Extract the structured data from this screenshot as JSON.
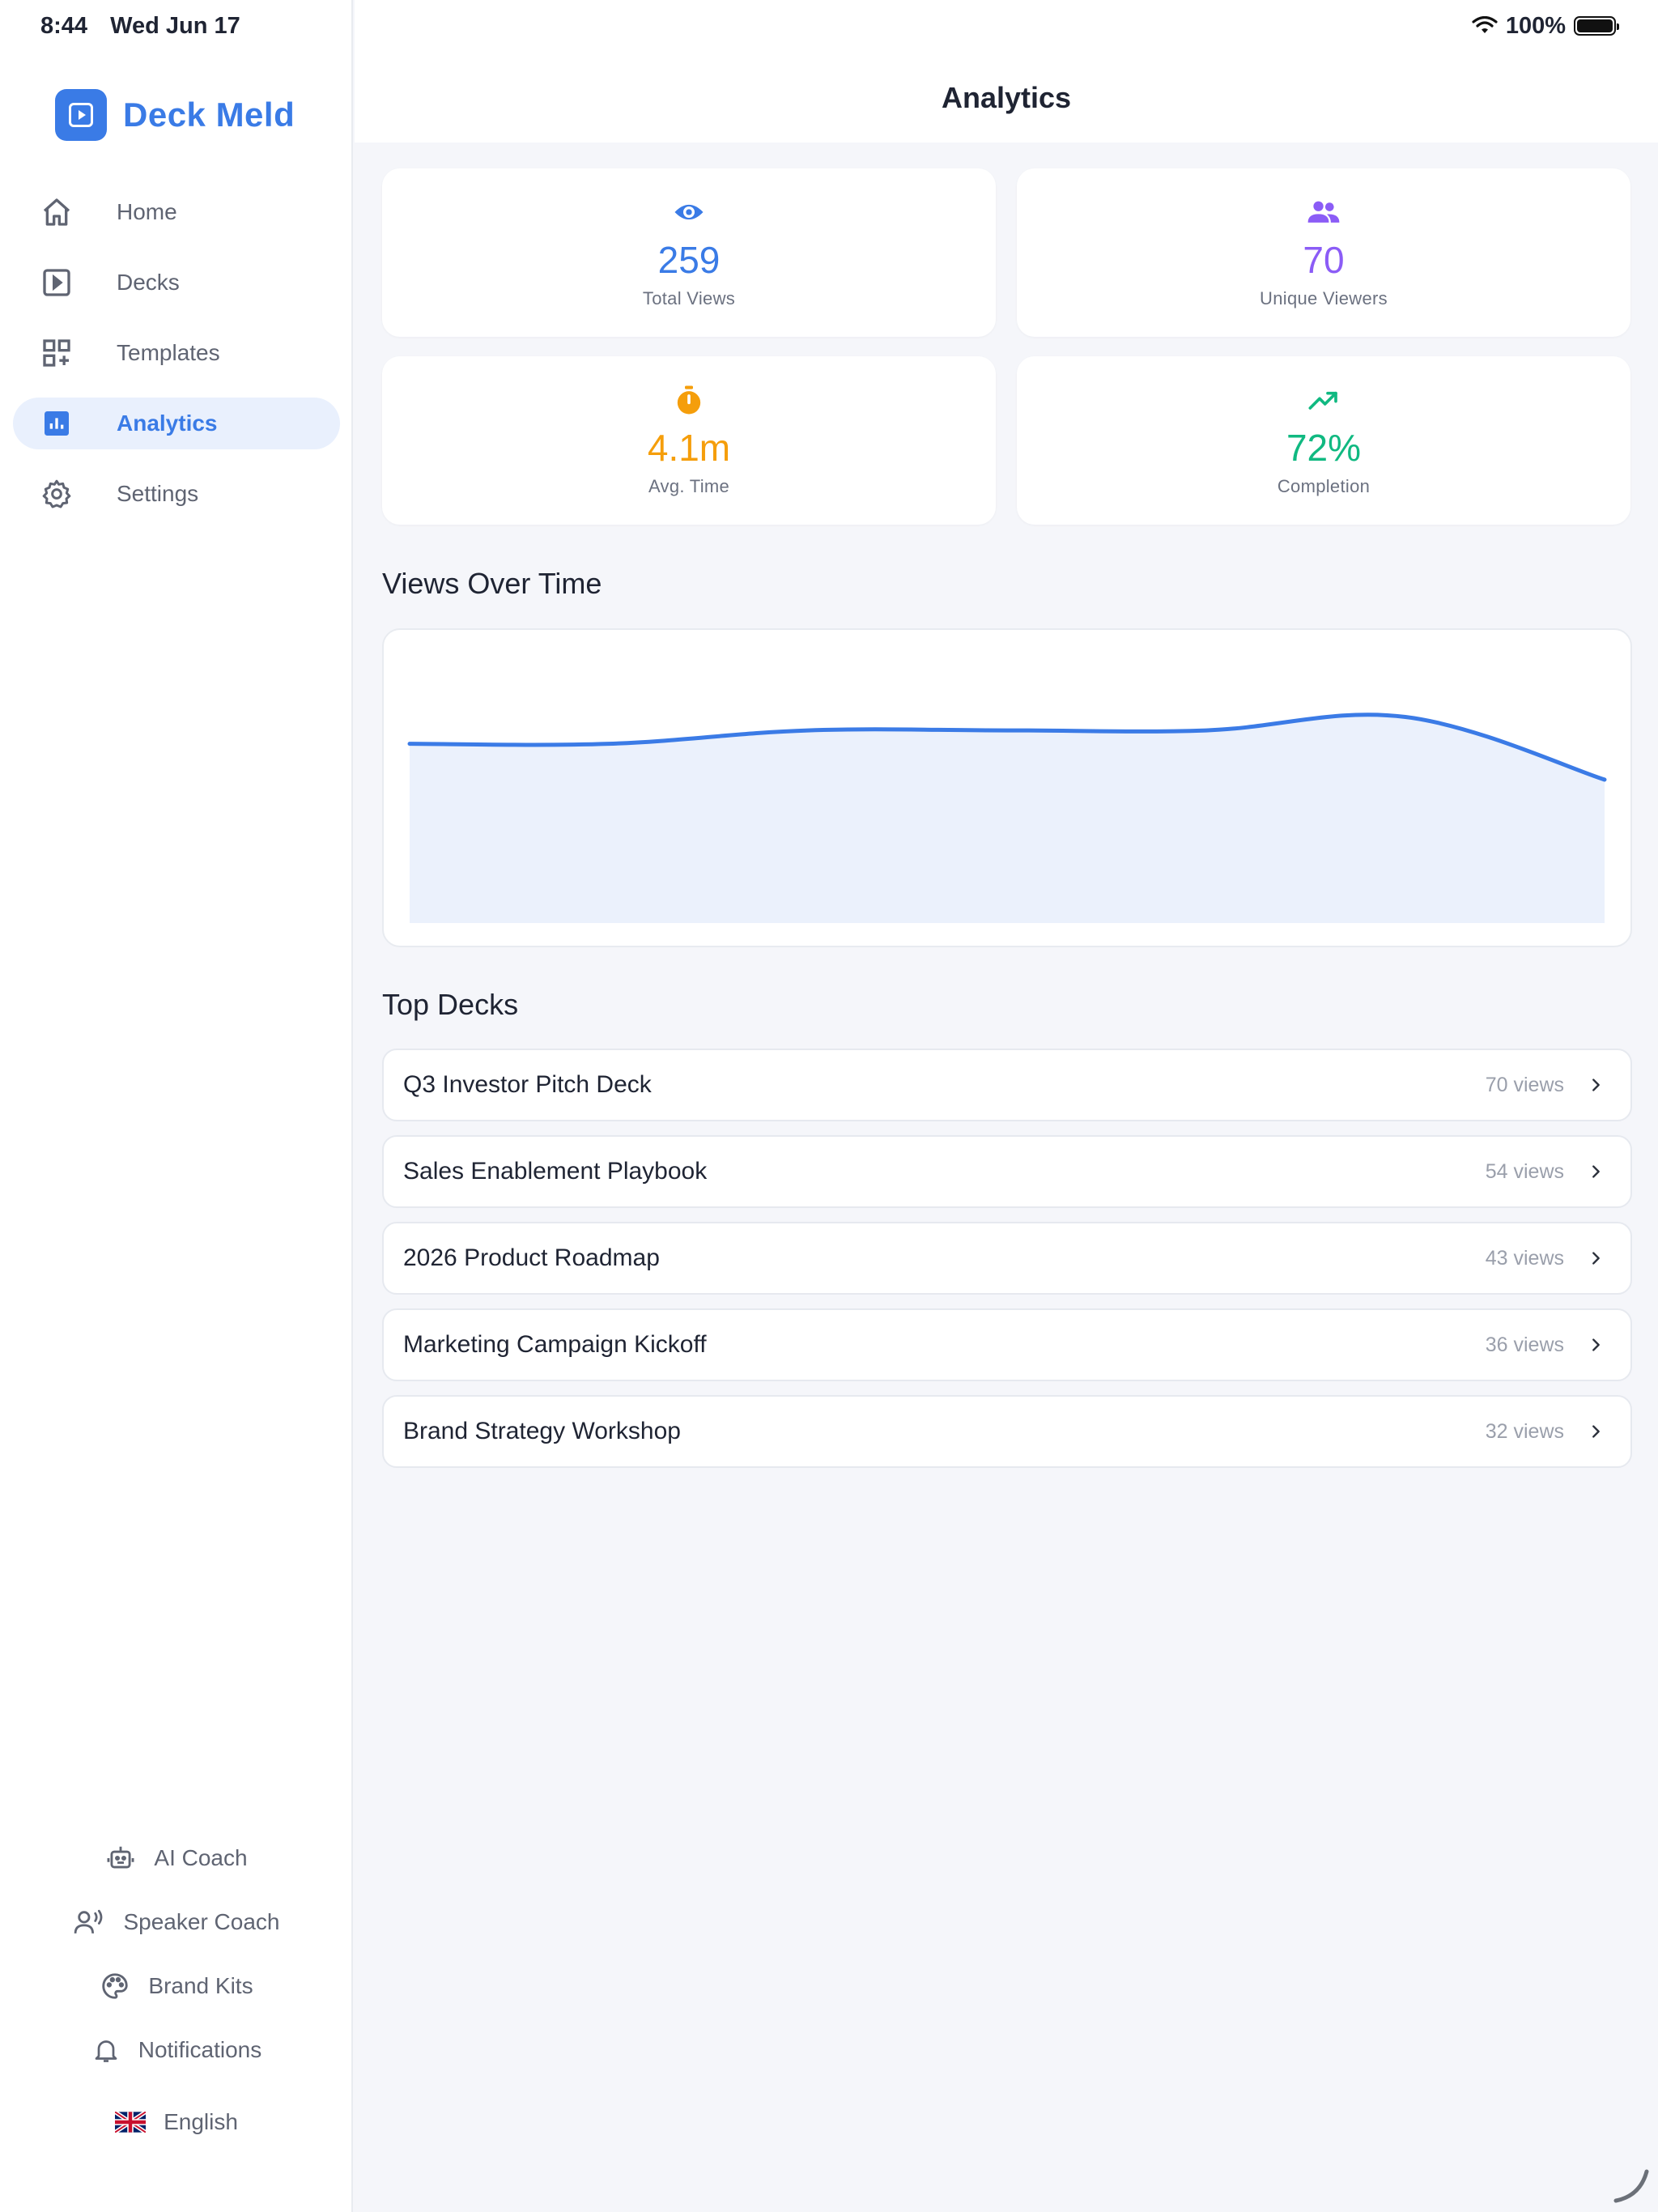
{
  "status_bar": {
    "time": "8:44",
    "date": "Wed Jun 17",
    "battery": "100%"
  },
  "brand": {
    "name": "Deck Meld",
    "color": "#3a7be6"
  },
  "nav": {
    "items": [
      {
        "label": "Home",
        "icon": "home-icon"
      },
      {
        "label": "Decks",
        "icon": "play-square-icon"
      },
      {
        "label": "Templates",
        "icon": "grid-add-icon"
      },
      {
        "label": "Analytics",
        "icon": "bar-chart-icon",
        "active": true
      },
      {
        "label": "Settings",
        "icon": "gear-icon"
      }
    ]
  },
  "secondary_nav": {
    "items": [
      {
        "label": "AI Coach",
        "icon": "robot-icon"
      },
      {
        "label": "Speaker Coach",
        "icon": "speaker-icon"
      },
      {
        "label": "Brand Kits",
        "icon": "palette-icon"
      },
      {
        "label": "Notifications",
        "icon": "bell-icon"
      }
    ],
    "language": {
      "label": "English",
      "icon": "uk-flag-icon"
    }
  },
  "header": {
    "title": "Analytics"
  },
  "stats": [
    {
      "value": "259",
      "label": "Total Views",
      "icon": "eye-icon",
      "color": "#3a7be6"
    },
    {
      "value": "70",
      "label": "Unique Viewers",
      "icon": "people-icon",
      "color": "#8b5cf6"
    },
    {
      "value": "4.1m",
      "label": "Avg. Time",
      "icon": "timer-icon",
      "color": "#f59e0b"
    },
    {
      "value": "72%",
      "label": "Completion",
      "icon": "trending-up-icon",
      "color": "#10b981"
    }
  ],
  "views_section": {
    "title": "Views Over Time"
  },
  "chart_data": {
    "type": "area",
    "x": [
      0,
      1,
      2,
      3,
      4,
      5,
      6
    ],
    "values": [
      40,
      40,
      43,
      43,
      43,
      46,
      32
    ],
    "ylim": [
      0,
      60
    ],
    "grid": false,
    "color": "#3b7be6",
    "fill": "#ebf1fc"
  },
  "top_decks": {
    "title": "Top Decks",
    "items": [
      {
        "name": "Q3 Investor Pitch Deck",
        "views": "70 views"
      },
      {
        "name": "Sales Enablement Playbook",
        "views": "54 views"
      },
      {
        "name": "2026 Product Roadmap",
        "views": "43 views"
      },
      {
        "name": "Marketing Campaign Kickoff",
        "views": "36 views"
      },
      {
        "name": "Brand Strategy Workshop",
        "views": "32 views"
      }
    ]
  }
}
